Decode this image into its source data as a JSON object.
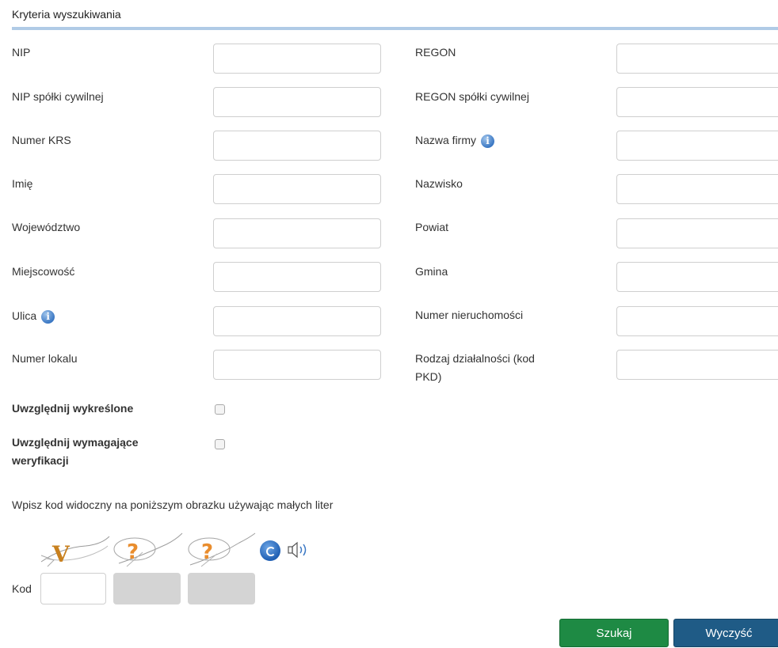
{
  "section": {
    "title": "Kryteria wyszukiwania"
  },
  "fields": {
    "nip": "NIP",
    "regon": "REGON",
    "nip_spolki": "NIP spółki cywilnej",
    "regon_spolki": "REGON spółki cywilnej",
    "krs": "Numer KRS",
    "nazwa_firmy": "Nazwa firmy",
    "imie": "Imię",
    "nazwisko": "Nazwisko",
    "wojewodztwo": "Województwo",
    "powiat": "Powiat",
    "miejscowosc": "Miejscowość",
    "gmina": "Gmina",
    "ulica": "Ulica",
    "numer_nieruchomosci": "Numer nieruchomości",
    "numer_lokalu": "Numer lokalu",
    "pkd_line1": "Rodzaj działalności (kod",
    "pkd_line2": "PKD)"
  },
  "checkboxes": {
    "wykreslone": "Uwzględnij wykreślone",
    "weryfikacji_line1": "Uwzględnij wymagające",
    "weryfikacji_line2": "weryfikacji"
  },
  "captcha": {
    "instruction": "Wpisz kod widoczny na poniższym obrazku używając małych liter",
    "tiles": [
      "V",
      "?",
      "?"
    ],
    "code_label": "Kod"
  },
  "info_icon_glyph": "i",
  "buttons": {
    "search": "Szukaj",
    "clear": "Wyczyść"
  }
}
